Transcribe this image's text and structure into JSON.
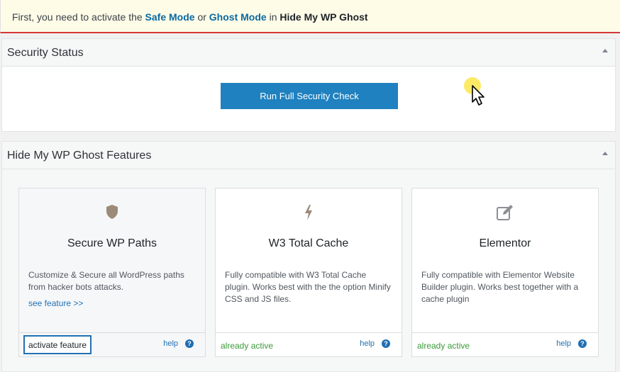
{
  "notice": {
    "prefix": "First, you need to activate the ",
    "safe_mode": "Safe Mode",
    "or": " or ",
    "ghost_mode": "Ghost Mode",
    "in": " in ",
    "plugin": "Hide My WP Ghost"
  },
  "security_status": {
    "title": "Security Status",
    "run_button": "Run Full Security Check"
  },
  "features": {
    "title": "Hide My WP Ghost Features",
    "cards": [
      {
        "icon": "shield-icon",
        "title": "Secure WP Paths",
        "description": "Customize & Secure all WordPress paths from hacker bots attacks.",
        "see_feature": "see feature >>",
        "action": "activate feature",
        "help": "help"
      },
      {
        "icon": "bolt-icon",
        "title": "W3 Total Cache",
        "description": "Fully compatible with W3 Total Cache plugin. Works best with the the option Minify CSS and JS files.",
        "status": "already active",
        "help": "help"
      },
      {
        "icon": "edit-icon",
        "title": "Elementor",
        "description": "Fully compatible with Elementor Website Builder plugin. Works best together with a cache plugin",
        "status": "already active",
        "help": "help"
      }
    ]
  },
  "colors": {
    "accent": "#1f81bf",
    "notice_bg": "#fefbe7",
    "notice_border": "#d63638",
    "active_green": "#3a9a3a"
  }
}
